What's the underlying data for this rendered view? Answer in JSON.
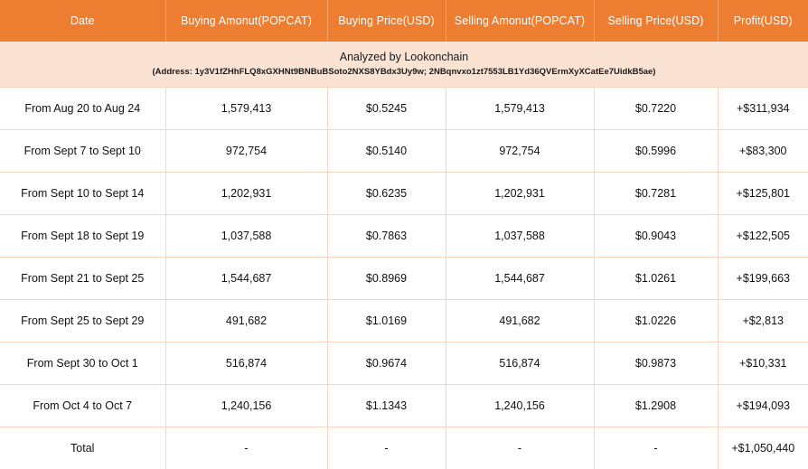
{
  "table": {
    "columns": [
      {
        "key": "date",
        "label": "Date"
      },
      {
        "key": "buy_amt",
        "label": "Buying Amonut(POPCAT)"
      },
      {
        "key": "buy_px",
        "label": "Buying Price(USD)"
      },
      {
        "key": "sell_amt",
        "label": "Selling Amonut(POPCAT)"
      },
      {
        "key": "sell_px",
        "label": "Selling Price(USD)"
      },
      {
        "key": "profit",
        "label": "Profit(USD)"
      }
    ],
    "attribution": {
      "title": "Analyzed by Lookonchain",
      "address": "(Address: 1y3V1fZHhFLQ8xGXHNt9BNBuBSoto2NXS8YBdx3Uy9w; 2NBqnvxo1zt7553LB1Yd36QVErmXyXCatEe7UidkB5ae)"
    },
    "rows": [
      {
        "date": "From Aug 20 to Aug 24",
        "buy_amt": "1,579,413",
        "buy_px": "$0.5245",
        "sell_amt": "1,579,413",
        "sell_px": "$0.7220",
        "profit": "+$311,934"
      },
      {
        "date": "From Sept 7 to Sept 10",
        "buy_amt": "972,754",
        "buy_px": "$0.5140",
        "sell_amt": "972,754",
        "sell_px": "$0.5996",
        "profit": "+$83,300"
      },
      {
        "date": "From Sept 10 to Sept 14",
        "buy_amt": "1,202,931",
        "buy_px": "$0.6235",
        "sell_amt": "1,202,931",
        "sell_px": "$0.7281",
        "profit": "+$125,801"
      },
      {
        "date": "From Sept 18 to Sept 19",
        "buy_amt": "1,037,588",
        "buy_px": "$0.7863",
        "sell_amt": "1,037,588",
        "sell_px": "$0.9043",
        "profit": "+$122,505"
      },
      {
        "date": "From Sept 21 to Sept 25",
        "buy_amt": "1,544,687",
        "buy_px": "$0.8969",
        "sell_amt": "1,544,687",
        "sell_px": "$1.0261",
        "profit": "+$199,663"
      },
      {
        "date": "From Sept 25 to Sept 29",
        "buy_amt": "491,682",
        "buy_px": "$1.0169",
        "sell_amt": "491,682",
        "sell_px": "$1.0226",
        "profit": "+$2,813"
      },
      {
        "date": "From Sept 30 to Oct 1",
        "buy_amt": "516,874",
        "buy_px": "$0.9674",
        "sell_amt": "516,874",
        "sell_px": "$0.9873",
        "profit": "+$10,331"
      },
      {
        "date": "From Oct 4 to Oct 7",
        "buy_amt": "1,240,156",
        "buy_px": "$1.1343",
        "sell_amt": "1,240,156",
        "sell_px": "$1.2908",
        "profit": "+$194,093"
      },
      {
        "date": "Total",
        "buy_amt": "-",
        "buy_px": "-",
        "sell_amt": "-",
        "sell_px": "-",
        "profit": "+$1,050,440",
        "is_total": true
      }
    ]
  },
  "colors": {
    "header_bg": "#ED7D31",
    "header_text": "#FFFFFF",
    "band_bg": "#FBE3D3",
    "border": "#F7D5BE",
    "profit_green": "#19B877",
    "body_text": "#111111"
  }
}
